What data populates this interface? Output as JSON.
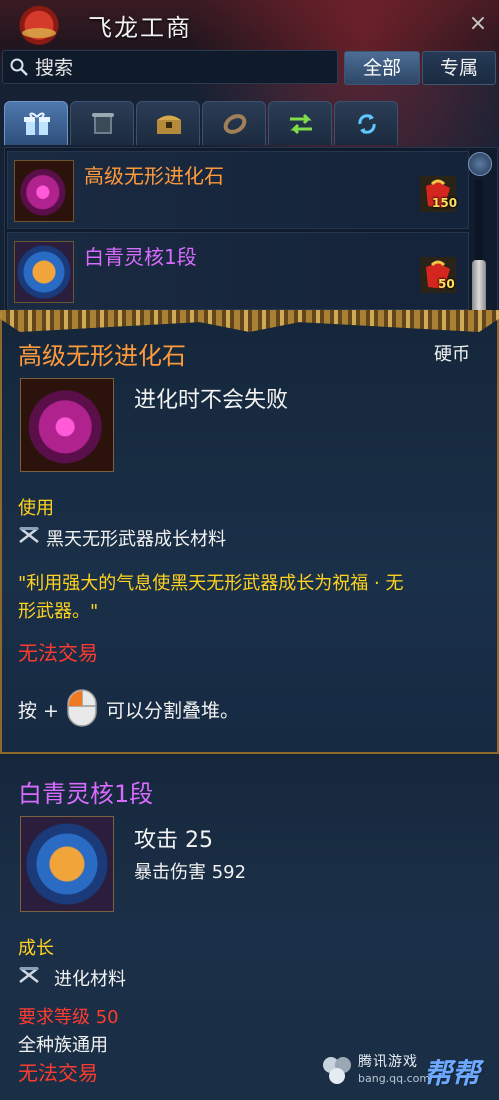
{
  "window": {
    "title": "飞龙工商",
    "close": "×"
  },
  "search": {
    "placeholder": "搜索"
  },
  "filters": {
    "all": "全部",
    "exclusive": "专属"
  },
  "category_tabs": [
    {
      "icon": "gift-icon"
    },
    {
      "icon": "scroll-icon"
    },
    {
      "icon": "chest-icon"
    },
    {
      "icon": "ring-icon"
    },
    {
      "icon": "exchange-arrows-icon"
    },
    {
      "icon": "refresh-icon"
    }
  ],
  "list_items": [
    {
      "name": "高级无形进化石",
      "price": "150",
      "name_color": "#ff9a3c"
    },
    {
      "name": "白青灵核1段",
      "price": "50",
      "name_color": "#d86cff"
    }
  ],
  "tooltip1": {
    "title": "高级无形进化石",
    "currency": "硬币",
    "description": "进化时不会失败",
    "usage_header": "使用",
    "usage_line": "黑天无形武器成长材料",
    "quote_line1": "\"利用强大的气息使黑天无形武器成长为祝福 · 无",
    "quote_line2": "形武器。\"",
    "trade": "无法交易",
    "split_prefix": "按 +",
    "split_suffix": "可以分割叠堆。"
  },
  "tooltip2": {
    "title": "白青灵核1段",
    "attack": "攻击 25",
    "crit": "暴击伤害 592",
    "growth_header": "成长",
    "growth_line": "进化材料",
    "level_req": "要求等级 50",
    "race": "全种族通用",
    "trade": "无法交易"
  },
  "watermark": {
    "text": "腾讯游戏",
    "sub": "bang.qq.com",
    "big": "帮帮"
  },
  "colors": {
    "orange_title": "#ff9a3c",
    "purple_title": "#d86cff",
    "yellow_text": "#ffd21e",
    "red_text": "#ff3b2f"
  }
}
